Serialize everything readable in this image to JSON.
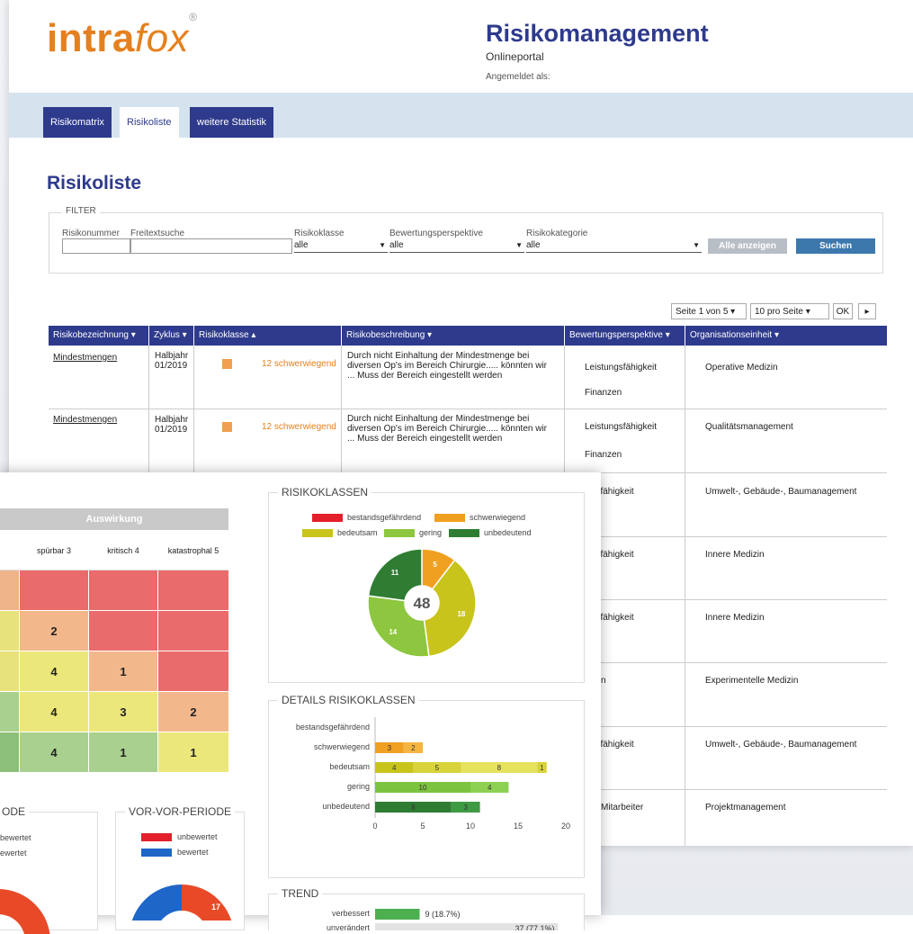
{
  "brand": {
    "logo_bold": "intra",
    "logo_light": "fox",
    "logo_reg": "®"
  },
  "header": {
    "title": "Risikomanagement",
    "subtitle": "Onlineportal",
    "login": "Angemeldet als:"
  },
  "nav": {
    "tabs": [
      "Risikomatrix",
      "Risikoliste",
      "weitere Statistik"
    ],
    "active": 1
  },
  "page_title": "Risikoliste",
  "filter": {
    "legend": "FILTER",
    "labels": [
      "Risikonummer",
      "Freitextsuche",
      "Risikoklasse",
      "Bewertungsperspektive",
      "Risikokategorie"
    ],
    "selects": [
      "alle",
      "alle",
      "alle"
    ],
    "buttons": [
      "Alle anzeigen",
      "Suchen"
    ]
  },
  "pager": {
    "page": "Seite 1 von 5",
    "per_page": "10 pro Seite",
    "ok": "OK",
    "next": "▸"
  },
  "table": {
    "columns": [
      "Risikobezeichnung",
      "Zyklus",
      "Risikoklasse",
      "Risikobeschreibung",
      "Bewertungsperspektive",
      "Organisationseinheit"
    ],
    "rows": [
      {
        "name": "Mindestmengen",
        "cycle": "Halbjahr\n01/2019",
        "class": "12 schwerwiegend",
        "desc": "Durch nicht Einhaltung der Mindestmenge bei diversen Op's im Bereich Chirurgie..... könnten wir ... Muss der Bereich eingestellt werden",
        "persp1": "Leistungsfähigkeit",
        "persp2": "Finanzen",
        "org": "Operative Medizin"
      },
      {
        "name": "Mindestmengen",
        "cycle": "Halbjahr\n01/2019",
        "class": "12 schwerwiegend",
        "desc": "Durch nicht Einhaltung der Mindestmenge bei diversen Op's im Bereich Chirurgie..... könnten wir ... Muss der Bereich eingestellt werden",
        "persp1": "Leistungsfähigkeit",
        "persp2": "Finanzen",
        "org": "Qualitätsmanagement"
      },
      {
        "persp1": "stungsfähigkeit",
        "persp2": "anzen",
        "org": "Umwelt-, Gebäude-, Baumanagement"
      },
      {
        "persp1": "stungsfähigkeit",
        "persp2": "anzen",
        "org": "Innere Medizin"
      },
      {
        "persp1": "stungsfähigkeit",
        "persp2": "anzen",
        "org": "Innere Medizin"
      },
      {
        "persp1": "putation",
        "persp2": "anzen",
        "org": "Experimentelle Medizin"
      },
      {
        "persp1": "stungsfähigkeit",
        "persp2": "anzen",
        "org": "Umwelt-, Gebäude-, Baumanagement"
      },
      {
        "persp1": "ienten/Mitarbeiter",
        "persp2": "",
        "org": "Projektmanagement"
      }
    ]
  },
  "colors": {
    "navy": "#2e3a8c",
    "orange": "#e5801e",
    "red": "#e3202b",
    "amber": "#f0a020",
    "olive": "#c8c41c",
    "lightgreen": "#8dc63f",
    "darkgreen": "#2e7d32",
    "blue": "#1f66c9"
  },
  "matrix": {
    "header": "Auswirkung",
    "cols": [
      "spürbar 3",
      "kritisch 4",
      "katastrophal 5"
    ],
    "cells": [
      [
        "",
        "",
        ""
      ],
      [
        "2",
        "",
        ""
      ],
      [
        "4",
        "1",
        ""
      ],
      [
        "4",
        "3",
        "2"
      ],
      [
        "4",
        "1",
        "1"
      ]
    ]
  },
  "risikoklassen": {
    "title": "RISIKOKLASSEN",
    "legend": [
      "bestandsgefährdend",
      "schwerwiegend",
      "bedeutsam",
      "gering",
      "unbedeutend"
    ],
    "total": "48"
  },
  "details": {
    "title": "DETAILS RISIKOKLASSEN",
    "categories": [
      "bestandsgefährdend",
      "schwerwiegend",
      "bedeutsam",
      "gering",
      "unbedeutend"
    ],
    "ticks": [
      "0",
      "5",
      "10",
      "15",
      "20"
    ]
  },
  "trend": {
    "title": "TREND",
    "labels": [
      "verbessert",
      "unverändert"
    ],
    "values": [
      "9 (18.7%)",
      "37 (77.1%)"
    ]
  },
  "periods": {
    "vor_title": "ODE",
    "vor_legend": [
      "bewertet",
      "ewertet"
    ],
    "vorvor_title": "VOR-VOR-PERIODE",
    "vorvor_legend": [
      "unbewertet",
      "bewertet"
    ],
    "vorvor_value": "17"
  },
  "chart_data": [
    {
      "type": "pie",
      "title": "RISIKOKLASSEN",
      "categories": [
        "bestandsgefährdend",
        "schwerwiegend",
        "bedeutsam",
        "gering",
        "unbedeutend"
      ],
      "values": [
        0,
        5,
        18,
        14,
        11
      ],
      "total": 48,
      "colors": [
        "#e3202b",
        "#f0a020",
        "#c8c41c",
        "#8dc63f",
        "#2e7d32"
      ],
      "legend": "top"
    },
    {
      "type": "bar",
      "title": "DETAILS RISIKOKLASSEN",
      "orientation": "horizontal",
      "stacked": true,
      "categories": [
        "bestandsgefährdend",
        "schwerwiegend",
        "bedeutsam",
        "gering",
        "unbedeutend"
      ],
      "series": [
        {
          "values": [
            0,
            3,
            4,
            10,
            8
          ]
        },
        {
          "values": [
            0,
            2,
            5,
            4,
            3
          ]
        },
        {
          "values": [
            0,
            0,
            8,
            0,
            0
          ]
        },
        {
          "values": [
            0,
            0,
            1,
            0,
            0
          ]
        }
      ],
      "xlim": [
        0,
        20
      ],
      "xticks": [
        0,
        5,
        10,
        15,
        20
      ]
    },
    {
      "type": "bar",
      "title": "TREND",
      "orientation": "horizontal",
      "categories": [
        "verbessert",
        "unverändert"
      ],
      "values": [
        9,
        37
      ],
      "labels": [
        "9 (18.7%)",
        "37 (77.1%)"
      ]
    }
  ]
}
